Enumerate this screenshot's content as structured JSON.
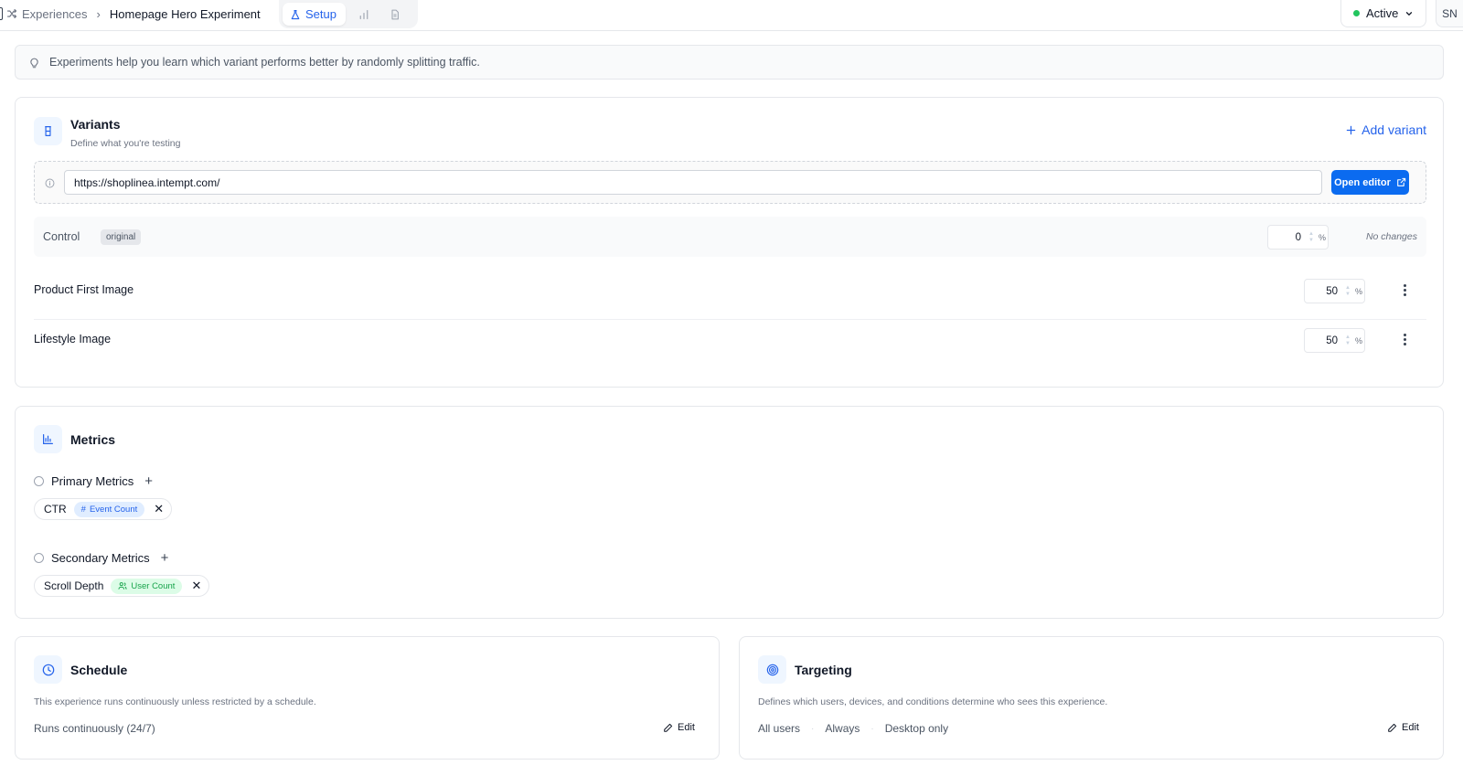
{
  "breadcrumb": {
    "parent": "Experiences",
    "separator": "›",
    "current": "Homepage Hero Experiment"
  },
  "tabs": {
    "setup": "Setup",
    "icons": [
      "bar-chart-icon",
      "document-icon"
    ]
  },
  "status": {
    "label": "Active",
    "color": "#22c55e"
  },
  "user": {
    "initials": "SN"
  },
  "banner": {
    "text": "Experiments help you learn which variant performs better by randomly splitting traffic."
  },
  "variants": {
    "title": "Variants",
    "subtitle": "Define what you're testing",
    "add_label": "Add variant",
    "url": "https://shoplinea.intempt.com/",
    "open_editor_label": "Open editor",
    "control": {
      "label": "Control",
      "badge": "original",
      "percent": "0",
      "unit": "%",
      "note": "No changes"
    },
    "items": [
      {
        "label": "Product First Image",
        "percent": "50",
        "unit": "%"
      },
      {
        "label": "Lifestyle Image",
        "percent": "50",
        "unit": "%"
      }
    ]
  },
  "metrics": {
    "title": "Metrics",
    "primary": {
      "title": "Primary Metrics",
      "items": [
        {
          "name": "CTR",
          "tag": "Event Count"
        }
      ]
    },
    "secondary": {
      "title": "Secondary Metrics",
      "items": [
        {
          "name": "Scroll Depth",
          "tag": "User Count"
        }
      ]
    }
  },
  "schedule": {
    "title": "Schedule",
    "description": "This experience runs continuously unless restricted by a schedule.",
    "value": "Runs continuously (24/7)",
    "edit_label": "Edit"
  },
  "targeting": {
    "title": "Targeting",
    "description": "Defines which users, devices, and conditions determine who sees this experience.",
    "values": [
      "All users",
      "Always",
      "Desktop only"
    ],
    "separator": "·",
    "edit_label": "Edit"
  },
  "colors": {
    "accent": "#2563eb",
    "primary_button": "#0b6bf0",
    "active_dot": "#22c55e"
  }
}
